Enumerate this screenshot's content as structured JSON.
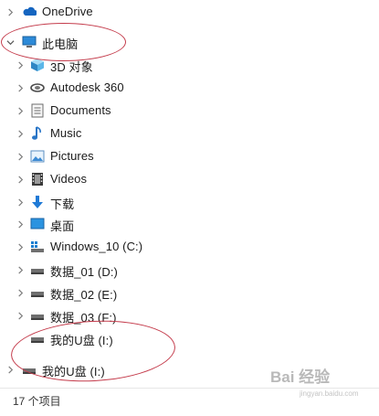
{
  "tree": {
    "onedrive": "OneDrive",
    "this_pc": "此电脑",
    "items": [
      {
        "label": "3D 对象",
        "icon": "3d-objects-icon"
      },
      {
        "label": "Autodesk 360",
        "icon": "autodesk-360-icon"
      },
      {
        "label": "Documents",
        "icon": "documents-icon"
      },
      {
        "label": "Music",
        "icon": "music-icon"
      },
      {
        "label": "Pictures",
        "icon": "pictures-icon"
      },
      {
        "label": "Videos",
        "icon": "videos-icon"
      },
      {
        "label": "下载",
        "icon": "downloads-icon"
      },
      {
        "label": "桌面",
        "icon": "desktop-icon"
      },
      {
        "label": "Windows_10 (C:)",
        "icon": "windows-drive-icon"
      },
      {
        "label": "数据_01 (D:)",
        "icon": "drive-icon"
      },
      {
        "label": "数据_02 (E:)",
        "icon": "drive-icon"
      },
      {
        "label": "数据_03 (F:)",
        "icon": "drive-icon"
      },
      {
        "label": "我的U盘 (I:)",
        "icon": "usb-drive-icon"
      }
    ],
    "usb_root": "我的U盘 (I:)"
  },
  "status": {
    "item_count": "17 个项目"
  },
  "watermark": {
    "text": "Bai 经验",
    "sub": "jingyan.baidu.com"
  },
  "colors": {
    "annotation": "#c43b4b",
    "accent": "#1e90ff"
  }
}
